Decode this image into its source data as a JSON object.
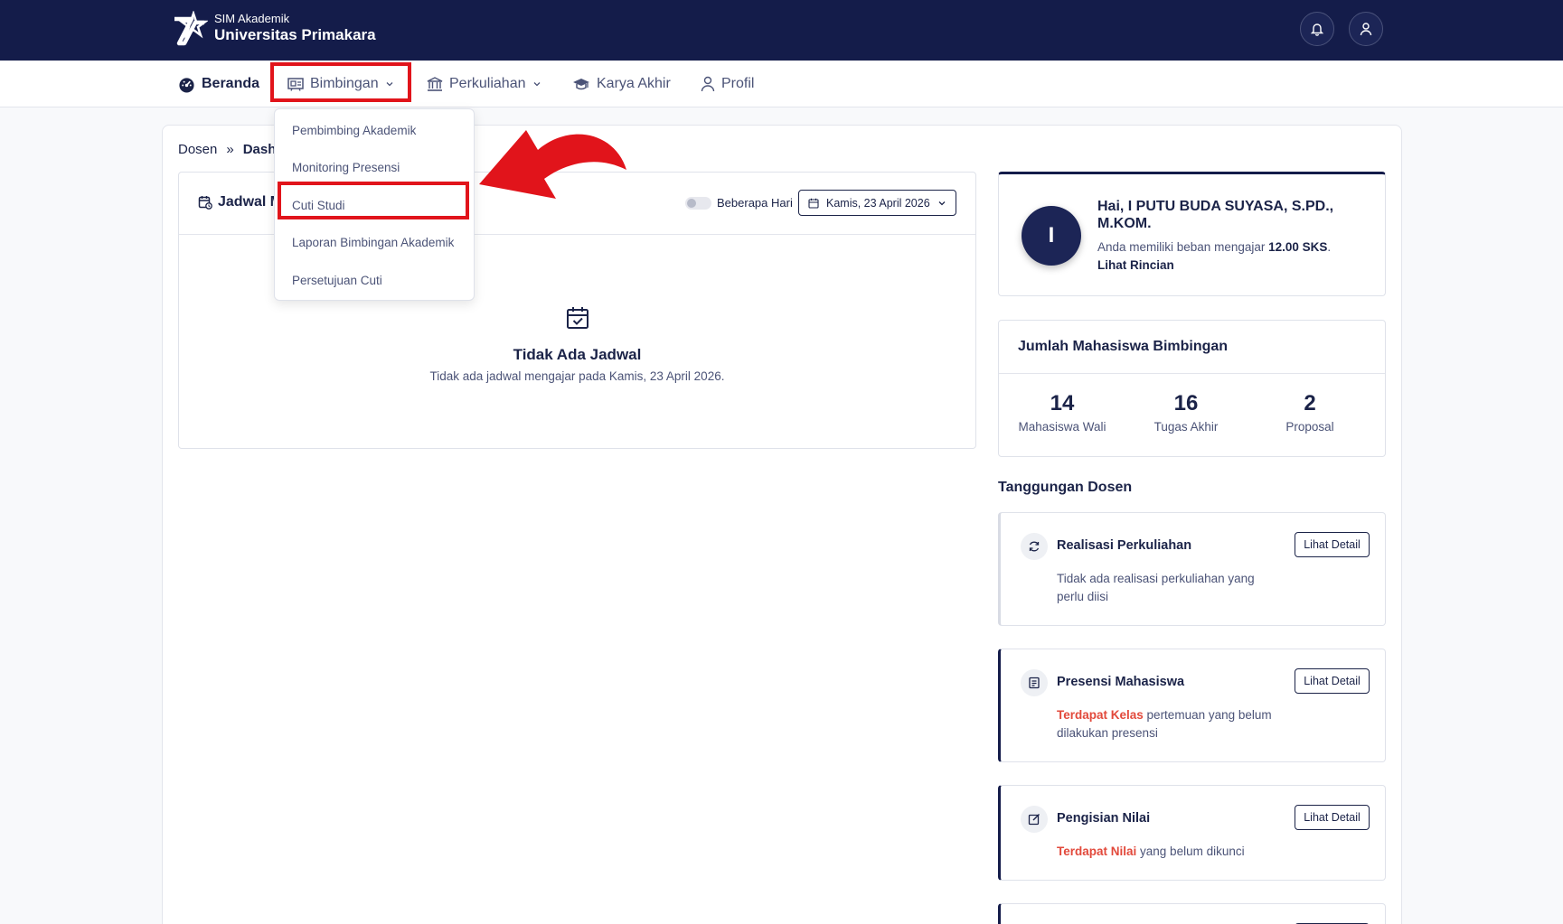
{
  "header": {
    "brand_sub": "SIM Akademik",
    "brand_main": "Universitas Primakara",
    "notification_icon": "bell-icon",
    "user_icon": "user-icon",
    "background": "#141c4a"
  },
  "nav": {
    "items": [
      {
        "label": "Beranda",
        "icon": "dashboard-icon"
      },
      {
        "label": "Bimbingan",
        "icon": "presentation-icon"
      },
      {
        "label": "Perkuliahan",
        "icon": "building-icon"
      },
      {
        "label": "Karya Akhir",
        "icon": "graduation-cap-icon"
      },
      {
        "label": "Profil",
        "icon": "user-icon"
      }
    ]
  },
  "dropdown": {
    "items": [
      "Pembimbing Akademik",
      "Monitoring Presensi",
      "Cuti Studi",
      "Laporan Bimbingan Akademik",
      "Persetujuan Cuti"
    ]
  },
  "annotation": {
    "highlight_color": "#e1141b"
  },
  "breadcrumb": {
    "items": [
      "Dosen",
      "Dash"
    ],
    "separator": "»"
  },
  "schedule": {
    "title": "Jadwal M",
    "toggle_label": "Beberapa Hari",
    "date_value": "Kamis, 23 April 2026",
    "empty_title": "Tidak Ada Jadwal",
    "empty_subtitle": "Tidak ada jadwal mengajar pada Kamis, 23 April 2026."
  },
  "profile": {
    "avatar_initial": "I",
    "greeting": "Hai, I PUTU BUDA SUYASA, S.PD., M.KOM.",
    "load_prefix": "Anda memiliki beban mengajar",
    "load_value": "12.00 SKS",
    "load_suffix": ".",
    "link": "Lihat Rincian"
  },
  "counts": {
    "title": "Jumlah Mahasiswa Bimbingan",
    "stats": [
      {
        "value": "14",
        "label": "Mahasiswa Wali"
      },
      {
        "value": "16",
        "label": "Tugas Akhir"
      },
      {
        "value": "2",
        "label": "Proposal"
      }
    ]
  },
  "responsibilities": {
    "title": "Tanggungan Dosen",
    "button_label": "Lihat Detail",
    "items": [
      {
        "title": "Realisasi Perkuliahan",
        "icon": "refresh-icon",
        "highlight": "",
        "desc": "Tidak ada realisasi perkuliahan yang perlu diisi"
      },
      {
        "title": "Presensi Mahasiswa",
        "icon": "document-icon",
        "highlight": "Terdapat Kelas",
        "desc": " pertemuan yang belum dilakukan presensi"
      },
      {
        "title": "Pengisian Nilai",
        "icon": "edit-icon",
        "highlight": "Terdapat Nilai",
        "desc": " yang belum dikunci"
      }
    ]
  }
}
